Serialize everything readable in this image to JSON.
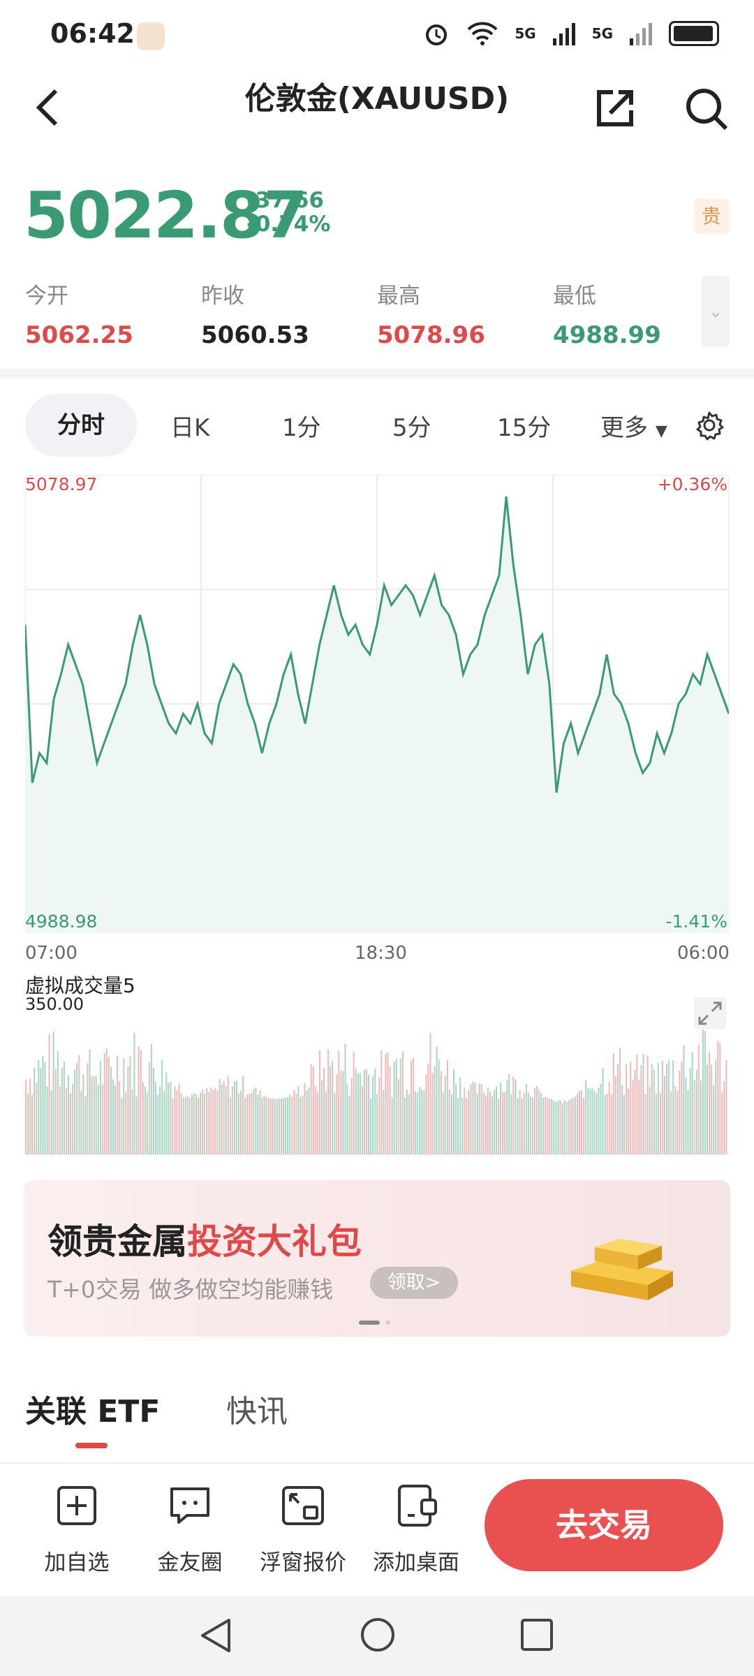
{
  "status_bar": {
    "time": "06:42",
    "network": "5G",
    "network2": "5G"
  },
  "header": {
    "title": "伦敦金(XAUUSD)"
  },
  "quote": {
    "price": "5022.87",
    "change": "-37.66",
    "change_pct": "-0.74%",
    "tag": "贵",
    "stats": [
      {
        "label": "今开",
        "value": "5062.25",
        "color": "red"
      },
      {
        "label": "昨收",
        "value": "5060.53",
        "color": "black"
      },
      {
        "label": "最高",
        "value": "5078.96",
        "color": "red"
      },
      {
        "label": "最低",
        "value": "4988.99",
        "color": "green"
      }
    ]
  },
  "tabs": {
    "active": "分时",
    "items": [
      "日K",
      "1分",
      "5分",
      "15分",
      "更多"
    ]
  },
  "chart_data": {
    "type": "area",
    "y_max_label": "5078.97",
    "y_min_label": "4988.98",
    "pct_max_label": "+0.36%",
    "pct_min_label": "-1.41%",
    "x_labels": [
      "07:00",
      "18:30",
      "06:00"
    ],
    "ylim": [
      4988.98,
      5078.97
    ],
    "series": [
      {
        "values": [
          5050,
          5018,
          5024,
          5022,
          5035,
          5040,
          5046,
          5042,
          5038,
          5030,
          5022,
          5026,
          5030,
          5034,
          5038,
          5046,
          5052,
          5046,
          5038,
          5034,
          5030,
          5028,
          5032,
          5030,
          5034,
          5028,
          5026,
          5034,
          5038,
          5042,
          5040,
          5034,
          5030,
          5024,
          5030,
          5034,
          5040,
          5044,
          5036,
          5030,
          5038,
          5046,
          5052,
          5058,
          5052,
          5048,
          5050,
          5046,
          5044,
          5050,
          5058,
          5054,
          5056,
          5058,
          5056,
          5052,
          5056,
          5060,
          5054,
          5052,
          5048,
          5040,
          5044,
          5046,
          5052,
          5056,
          5060,
          5076,
          5062,
          5052,
          5040,
          5046,
          5048,
          5038,
          5016,
          5026,
          5030,
          5024,
          5028,
          5032,
          5036,
          5044,
          5036,
          5034,
          5030,
          5024,
          5020,
          5022,
          5028,
          5024,
          5028,
          5034,
          5036,
          5040,
          5038,
          5044,
          5040,
          5036,
          5032
        ]
      }
    ],
    "volume": {
      "title": "虚拟成交量5",
      "max_label": "350.00"
    }
  },
  "banner": {
    "title_plain": "领贵金属",
    "title_highlight": "投资大礼包",
    "subtitle": "T+0交易 做多做空均能赚钱",
    "button": "领取>"
  },
  "section_tabs": {
    "etf": "关联 ETF",
    "news": "快讯"
  },
  "actions": [
    {
      "label": "加自选"
    },
    {
      "label": "金友圈"
    },
    {
      "label": "浮窗报价"
    },
    {
      "label": "添加桌面"
    }
  ],
  "trade_button": "去交易",
  "colors": {
    "up": "#de4a4a",
    "down": "#3a9a73",
    "accent": "#e85150"
  }
}
